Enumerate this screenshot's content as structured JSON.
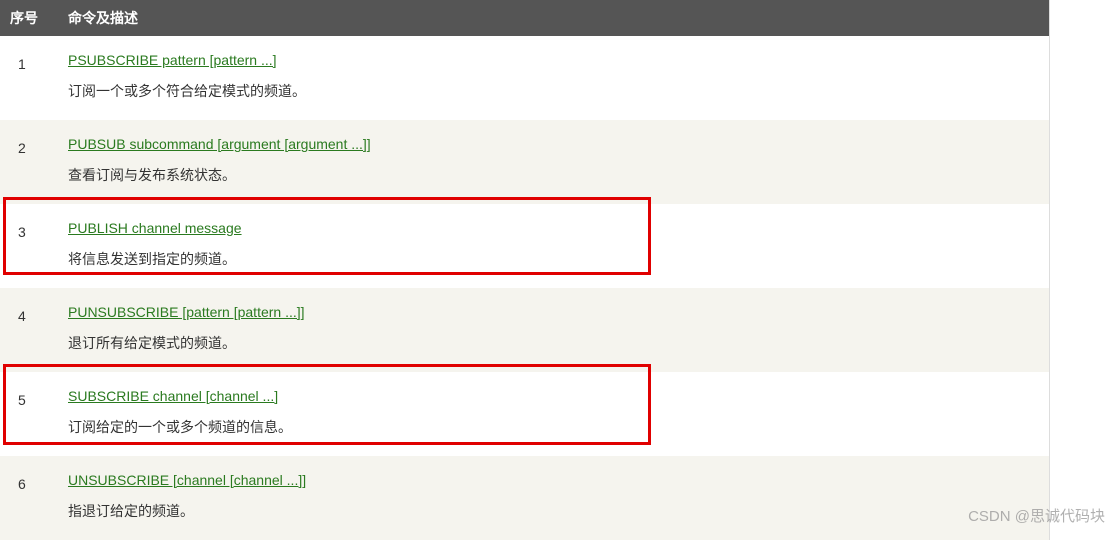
{
  "table": {
    "headers": {
      "num": "序号",
      "cmd": "命令及描述"
    },
    "rows": [
      {
        "num": "1",
        "link": "PSUBSCRIBE pattern [pattern ...]",
        "desc": "订阅一个或多个符合给定模式的频道。"
      },
      {
        "num": "2",
        "link": "PUBSUB subcommand [argument [argument ...]]",
        "desc": "查看订阅与发布系统状态。"
      },
      {
        "num": "3",
        "link": "PUBLISH channel message",
        "desc": "将信息发送到指定的频道。"
      },
      {
        "num": "4",
        "link": "PUNSUBSCRIBE [pattern [pattern ...]]",
        "desc": "退订所有给定模式的频道。"
      },
      {
        "num": "5",
        "link": "SUBSCRIBE channel [channel ...]",
        "desc": "订阅给定的一个或多个频道的信息。"
      },
      {
        "num": "6",
        "link": "UNSUBSCRIBE [channel [channel ...]]",
        "desc": "指退订给定的频道。"
      }
    ]
  },
  "watermark": "CSDN @思诚代码块"
}
